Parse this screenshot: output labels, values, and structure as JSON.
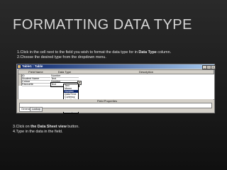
{
  "slide": {
    "title": "FORMATTING DATA TYPE",
    "step1_pre": "1.Click in the cell next  to the field you wish to format the data type for in ",
    "step1_bold": "Data Type",
    "step1_post": " column.",
    "step2": "2.Choose the desired type from the dropdown menu.",
    "step3_pre": "3.Click on ",
    "step3_bold": "the Data Sheet view",
    "step3_post": " button.",
    "step4": "4.Type in the data in the field."
  },
  "window": {
    "title": "Table1 : Table",
    "buttons": {
      "min": "_",
      "max": "□",
      "close": "x"
    },
    "headers": {
      "field_name": "Field Name",
      "data_type": "Data Type",
      "description": "Description"
    },
    "rows": [
      {
        "field": "ID",
        "type": "Number"
      },
      {
        "field": "Student Name",
        "type": "Text"
      },
      {
        "field": "Colour",
        "type": "Number"
      },
      {
        "field": "Favourite",
        "type": "Text"
      }
    ],
    "dropdown_options": [
      "Text",
      "Memo",
      "Number",
      "Date/Time",
      "Currency",
      "AutoNumber",
      "Yes/No",
      "OLE Object",
      "Hyperlink",
      "Lookup Wizard..."
    ],
    "dropdown_selected": "Number",
    "field_properties_label": "Field Properties",
    "tabs": {
      "general": "General",
      "lookup": "Lookup"
    }
  }
}
